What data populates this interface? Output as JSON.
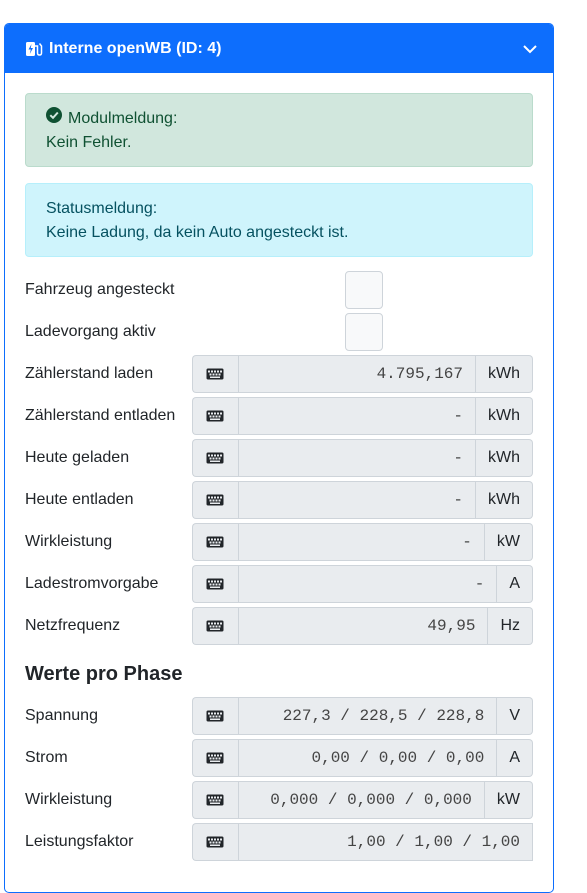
{
  "header": {
    "title": "Interne openWB (ID: 4)",
    "icon": "charging-station-icon"
  },
  "alerts": {
    "module": {
      "title": "Modulmeldung:",
      "text": "Kein Fehler."
    },
    "status": {
      "title": "Statusmeldung:",
      "text": "Keine Ladung, da kein Auto angesteckt ist."
    }
  },
  "checks": [
    {
      "label": "Fahrzeug angesteckt"
    },
    {
      "label": "Ladevorgang aktiv"
    }
  ],
  "fields": [
    {
      "label": "Zählerstand laden",
      "value": "4.795,167",
      "unit": "kWh"
    },
    {
      "label": "Zählerstand entladen",
      "value": "-",
      "unit": "kWh"
    },
    {
      "label": "Heute geladen",
      "value": "-",
      "unit": "kWh"
    },
    {
      "label": "Heute entladen",
      "value": "-",
      "unit": "kWh"
    },
    {
      "label": "Wirkleistung",
      "value": "-",
      "unit": "kW"
    },
    {
      "label": "Ladestromvorgabe",
      "value": "-",
      "unit": "A"
    },
    {
      "label": "Netzfrequenz",
      "value": "49,95",
      "unit": "Hz"
    }
  ],
  "phase_section": {
    "title": "Werte pro Phase"
  },
  "phase_fields": [
    {
      "label": "Spannung",
      "value": "227,3 / 228,5 / 228,8",
      "unit": "V"
    },
    {
      "label": "Strom",
      "value": "0,00 / 0,00 / 0,00",
      "unit": "A"
    },
    {
      "label": "Wirkleistung",
      "value": "0,000 / 0,000 / 0,000",
      "unit": "kW"
    },
    {
      "label": "Leistungsfaktor",
      "value": "1,00 / 1,00 / 1,00",
      "unit": ""
    }
  ]
}
